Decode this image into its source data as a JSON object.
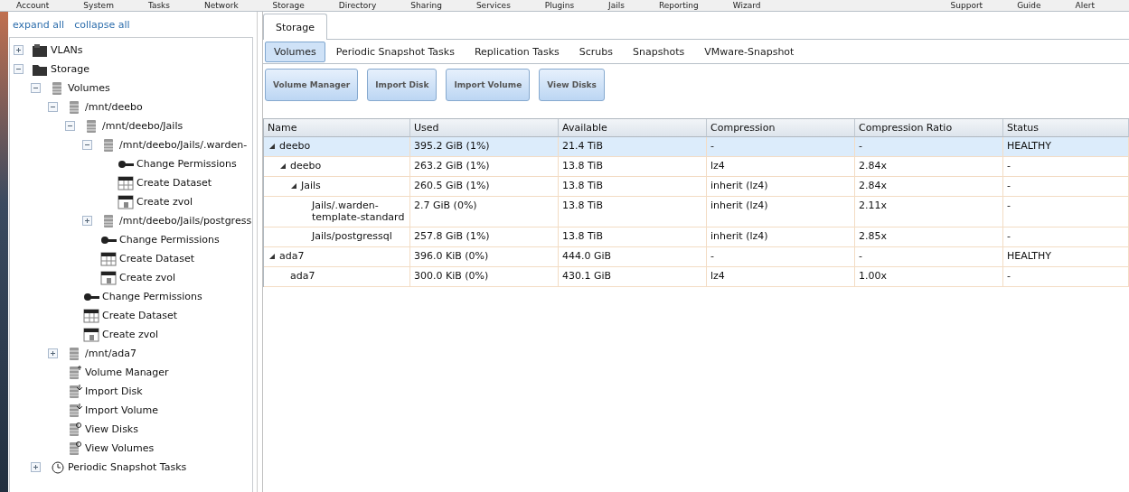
{
  "menu_bar": {
    "items": [
      "Account",
      "System",
      "Tasks",
      "Network",
      "Storage",
      "Directory",
      "Sharing",
      "Services",
      "Plugins",
      "Jails",
      "Reporting",
      "Wizard"
    ],
    "right_items": [
      "Support",
      "Guide",
      "Alert"
    ]
  },
  "sidebar": {
    "links": [
      "expand all",
      "collapse all"
    ],
    "tree": [
      {
        "label": "VLANs",
        "kind": "vlan",
        "expanded": false
      },
      {
        "label": "Storage",
        "kind": "folder",
        "expanded": true,
        "children": [
          {
            "label": "Volumes",
            "kind": "disk",
            "expanded": true,
            "children": [
              {
                "label": "/mnt/deebo",
                "kind": "disk",
                "expanded": true,
                "children": [
                  {
                    "label": "/mnt/deebo/Jails",
                    "kind": "disk",
                    "expanded": true,
                    "children": [
                      {
                        "label": "/mnt/deebo/Jails/.warden-",
                        "kind": "disk",
                        "expanded": true,
                        "children": [
                          {
                            "label": "Change Permissions",
                            "kind": "key"
                          },
                          {
                            "label": "Create Dataset",
                            "kind": "dataset"
                          },
                          {
                            "label": "Create zvol",
                            "kind": "zvol"
                          }
                        ]
                      },
                      {
                        "label": "/mnt/deebo/Jails/postgress",
                        "kind": "disk",
                        "expanded": false
                      },
                      {
                        "label": "Change Permissions",
                        "kind": "key"
                      },
                      {
                        "label": "Create Dataset",
                        "kind": "dataset"
                      },
                      {
                        "label": "Create zvol",
                        "kind": "zvol"
                      }
                    ]
                  },
                  {
                    "label": "Change Permissions",
                    "kind": "key"
                  },
                  {
                    "label": "Create Dataset",
                    "kind": "dataset"
                  },
                  {
                    "label": "Create zvol",
                    "kind": "zvol"
                  }
                ]
              },
              {
                "label": "/mnt/ada7",
                "kind": "disk",
                "expanded": false
              },
              {
                "label": "Volume Manager",
                "kind": "volmgr"
              },
              {
                "label": "Import Disk",
                "kind": "import"
              },
              {
                "label": "Import Volume",
                "kind": "import"
              },
              {
                "label": "View Disks",
                "kind": "view"
              },
              {
                "label": "View Volumes",
                "kind": "view"
              }
            ]
          },
          {
            "label": "Periodic Snapshot Tasks",
            "kind": "clock",
            "expanded": false
          }
        ]
      }
    ]
  },
  "tabs": [
    {
      "label": "Storage",
      "selected": true
    }
  ],
  "subtabs": [
    {
      "label": "Volumes",
      "selected": true
    },
    {
      "label": "Periodic Snapshot Tasks",
      "selected": false
    },
    {
      "label": "Replication Tasks",
      "selected": false
    },
    {
      "label": "Scrubs",
      "selected": false
    },
    {
      "label": "Snapshots",
      "selected": false
    },
    {
      "label": "VMware-Snapshot",
      "selected": false
    }
  ],
  "buttons": [
    "Volume Manager",
    "Import Disk",
    "Import Volume",
    "View Disks"
  ],
  "table": {
    "columns": [
      "Name",
      "Used",
      "Available",
      "Compression",
      "Compression Ratio",
      "Status"
    ],
    "rows": [
      {
        "cells": [
          "deebo",
          "395.2 GiB (1%)",
          "21.4 TiB",
          "-",
          "-",
          "HEALTHY"
        ],
        "selected": true,
        "expanded": true,
        "children": [
          {
            "cells": [
              "deebo",
              "263.2 GiB (1%)",
              "13.8 TiB",
              "lz4",
              "2.84x",
              "-"
            ],
            "selected": false,
            "expanded": true,
            "children": [
              {
                "cells": [
                  "Jails",
                  "260.5 GiB (1%)",
                  "13.8 TiB",
                  "inherit (lz4)",
                  "2.84x",
                  "-"
                ],
                "selected": false,
                "expanded": true,
                "children": [
                  {
                    "cells": [
                      "Jails/.warden-template-standard",
                      "2.7 GiB (0%)",
                      "13.8 TiB",
                      "inherit (lz4)",
                      "2.11x",
                      "-"
                    ],
                    "selected": false
                  },
                  {
                    "cells": [
                      "Jails/postgressql",
                      "257.8 GiB (1%)",
                      "13.8 TiB",
                      "inherit (lz4)",
                      "2.85x",
                      "-"
                    ],
                    "selected": false
                  }
                ]
              }
            ]
          }
        ]
      },
      {
        "cells": [
          "ada7",
          "396.0 KiB (0%)",
          "444.0 GiB",
          "-",
          "-",
          "HEALTHY"
        ],
        "selected": false,
        "expanded": true,
        "children": [
          {
            "cells": [
              "ada7",
              "300.0 KiB (0%)",
              "430.1 GiB",
              "lz4",
              "1.00x",
              "-"
            ],
            "selected": false
          }
        ]
      }
    ]
  }
}
